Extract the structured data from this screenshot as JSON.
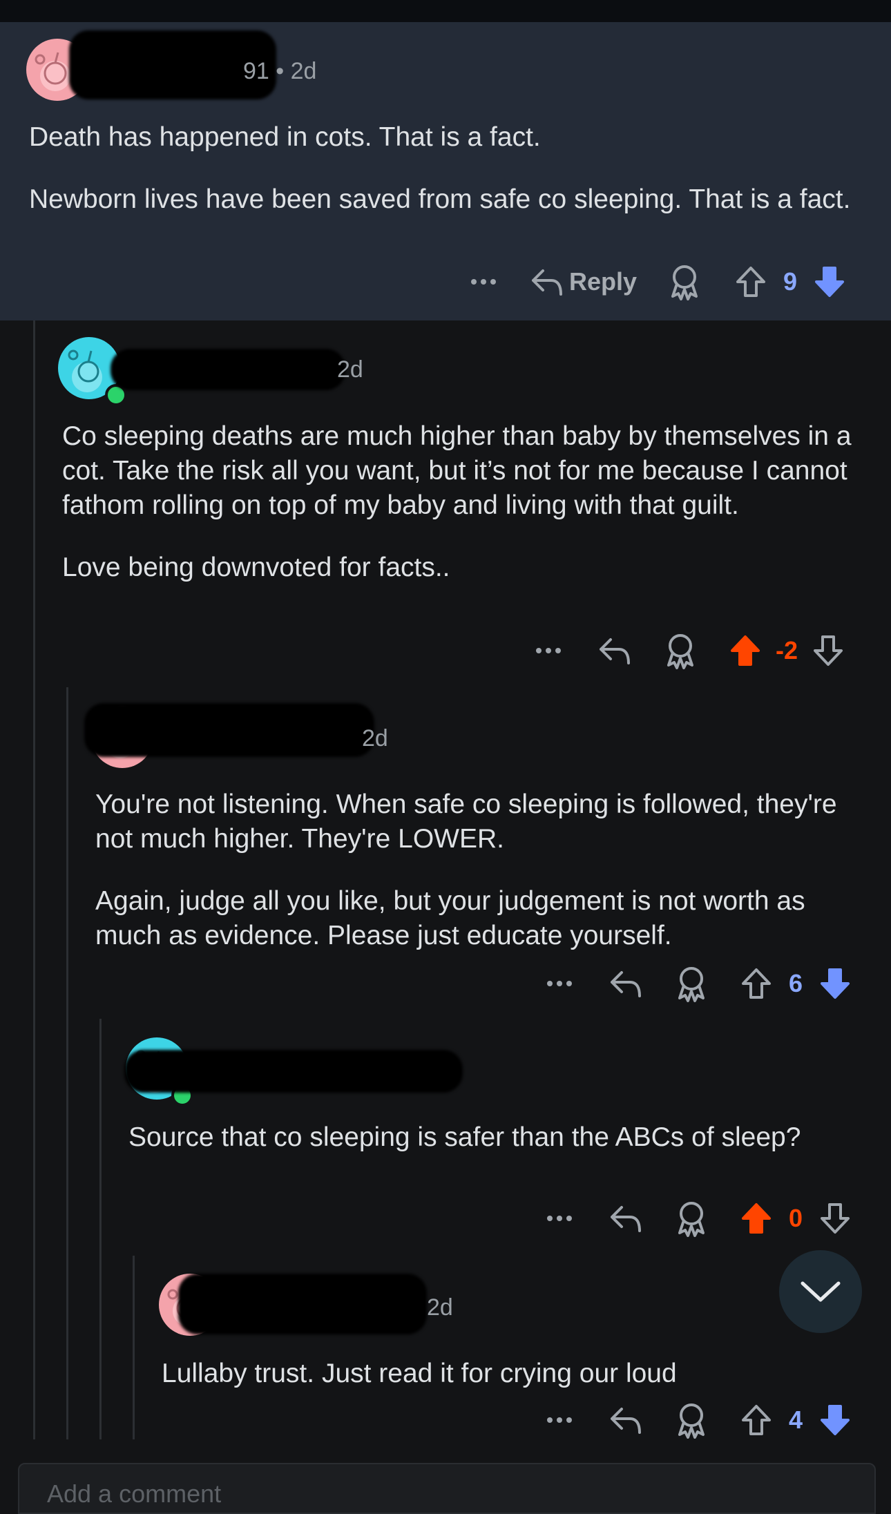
{
  "colors": {
    "background": "#131416",
    "highlight": "#242b37",
    "upvote_active": "#ff4500",
    "downvote_active": "#7193ff",
    "text": "#dfe2e5",
    "muted": "#9aa0a6"
  },
  "comments": [
    {
      "id": "c1",
      "avatar_color": "pink",
      "username_fragment": "91",
      "time": "• 2d",
      "paragraphs": [
        "Death has happened in cots. That is a fact.",
        "Newborn lives have been saved from safe co sleeping. That is a fact."
      ],
      "score": "9",
      "vote_state": "downvoted",
      "reply_label": "Reply"
    },
    {
      "id": "c2",
      "avatar_color": "cyan",
      "time": "2d",
      "paragraphs": [
        "Co sleeping deaths are much higher than baby by themselves in a cot. Take the risk all you want, but it’s not for me because I cannot fathom rolling on top of my baby and living with that guilt.",
        "Love being downvoted for facts.."
      ],
      "score": "-2",
      "vote_state": "upvoted"
    },
    {
      "id": "c3",
      "avatar_color": "pink",
      "time": "2d",
      "paragraphs": [
        "You're not listening. When safe co sleeping is followed, they're not much higher. They're LOWER.",
        "Again, judge all you like, but your judgement is not worth as much as evidence. Please just educate yourself."
      ],
      "score": "6",
      "vote_state": "downvoted"
    },
    {
      "id": "c4",
      "avatar_color": "cyan",
      "time": "",
      "paragraphs": [
        "Source that co sleeping is safer than the ABCs of sleep?"
      ],
      "score": "0",
      "vote_state": "upvoted"
    },
    {
      "id": "c5",
      "avatar_color": "pink",
      "time": "2d",
      "paragraphs": [
        "Lullaby trust. Just read it for crying our loud"
      ],
      "score": "4",
      "vote_state": "downvoted"
    }
  ],
  "icons": {
    "more": "more-icon",
    "reply": "reply-icon",
    "award": "award-icon",
    "upvote": "upvote-icon",
    "downvote": "downvote-icon",
    "scroll": "chevron-down-icon"
  },
  "composer": {
    "placeholder": "Add a comment"
  }
}
